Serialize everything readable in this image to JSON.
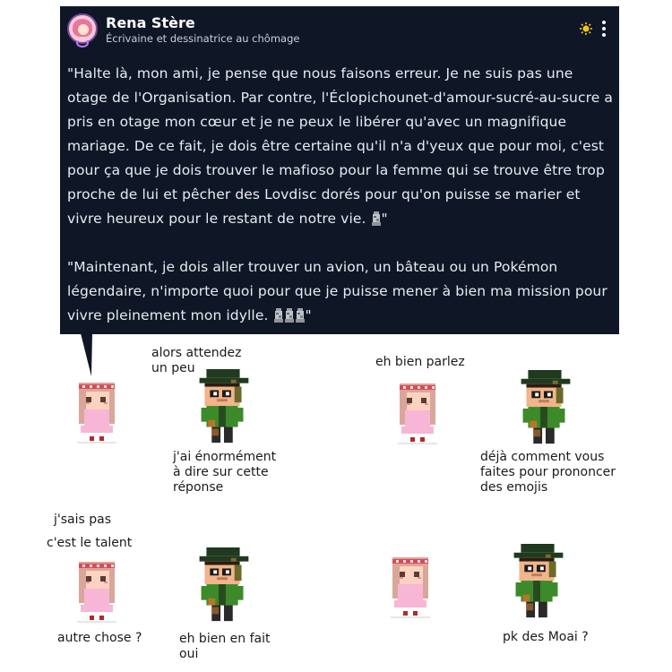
{
  "post": {
    "author": "Rena Stère",
    "bio": "Écrivaine et dessinatrice au chômage",
    "paragraph1": "\"Halte là, mon ami, je pense que nous faisons erreur. Je ne suis pas une otage de l'Organisation. Par contre, l'Éclopichounet-d'amour-sucré-au-sucre a pris en otage mon cœur et je ne peux le libérer qu'avec un magnifique mariage. De ce fait, je dois être certaine qu'il n'a d'yeux que pour moi, c'est pour ça que je dois trouver le mafioso pour la femme qui se trouve être trop proche de lui et pêcher des Lovdisc dorés pour qu'on puisse se marier et vivre heureux pour le restant de notre vie.",
    "paragraph1_end": "\"",
    "paragraph2": "\"Maintenant, je dois aller trouver un avion, un bâteau ou un Pokémon légendaire, n'importe quoi pour que je puisse mener à bien ma mission pour vivre pleinement mon idylle.",
    "paragraph2_end": "\""
  },
  "comic": {
    "p1_boy": "alors attendez\nun peu",
    "p1_boy_2": "j'ai énormément\nà dire sur cette\nréponse",
    "p2_girl": "eh bien parlez",
    "p2_boy": "déjà comment vous\nfaites pour prononcer\ndes emojis",
    "p3_girl_1": "j'sais pas",
    "p3_girl_2": "c'est le talent",
    "p3_girl_3": "autre chose ?",
    "p3_boy": "eh bien en fait\n   oui",
    "p4_boy": "pk des Moai ?"
  },
  "colors": {
    "card_bg": "#0f1727",
    "hair_girl": "#d9a79a",
    "dress": "#f7b6d6",
    "headband": "#d94a5a",
    "hat": "#1f3a1f",
    "jacket": "#3c8a2a",
    "skin": "#f2b48a"
  }
}
